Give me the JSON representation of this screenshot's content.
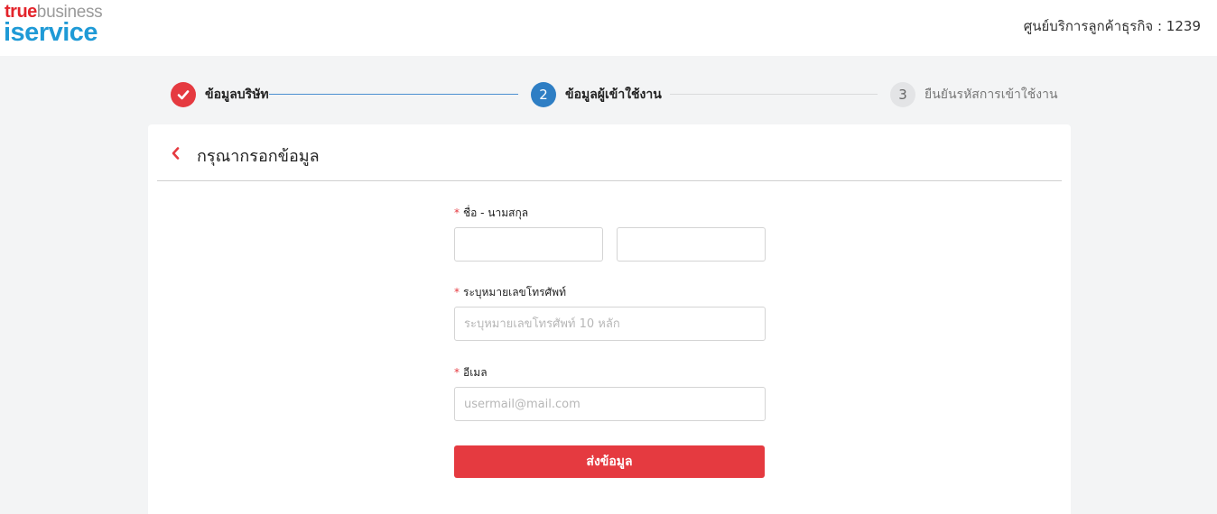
{
  "header": {
    "logo": {
      "word1": "true",
      "word2": "business",
      "word3": "iservice"
    },
    "support_label": "ศูนย์บริการลูกค้าธุรกิจ : 1239"
  },
  "stepper": {
    "steps": [
      {
        "label": "ข้อมูลบริษัท",
        "number": "",
        "state": "done"
      },
      {
        "label": "ข้อมูลผู้เข้าใช้งาน",
        "number": "2",
        "state": "active"
      },
      {
        "label": "ยืนยันรหัสการเข้าใช้งาน",
        "number": "3",
        "state": "pending"
      }
    ]
  },
  "form": {
    "title": "กรุณากรอกข้อมูล",
    "required_mark": "*",
    "name_label": "ชื่อ - นามสกุล",
    "first_name": {
      "value": "",
      "placeholder": ""
    },
    "last_name": {
      "value": "",
      "placeholder": ""
    },
    "phone_label": "ระบุหมายเลขโทรศัพท์",
    "phone": {
      "value": "",
      "placeholder": "ระบุหมายเลขโทรศัพท์ 10 หลัก"
    },
    "email_label": "อีเมล",
    "email": {
      "value": "",
      "placeholder": "usermail@mail.com"
    },
    "submit_label": "ส่งข้อมูล"
  },
  "colors": {
    "accent_red": "#e53a40",
    "accent_blue": "#2e7ec4",
    "brand_blue": "#1f9ad6",
    "background": "#f3f4f5"
  },
  "icons": {
    "step1": "checkmark-icon",
    "back": "chevron-left-icon"
  }
}
